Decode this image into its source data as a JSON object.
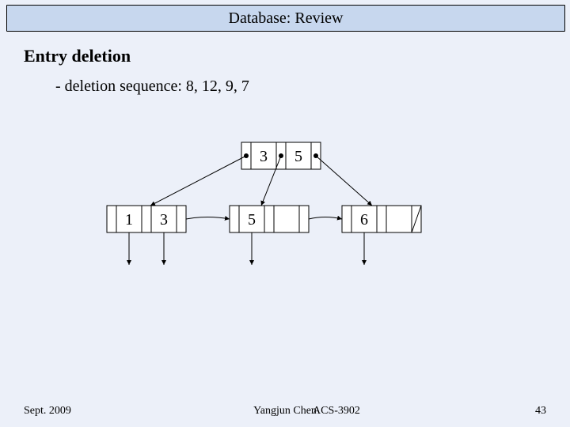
{
  "title": "Database: Review",
  "heading": "Entry deletion",
  "subheading": "- deletion sequence: 8, 12, 9, 7",
  "tree": {
    "root": {
      "keys": [
        "3",
        "5"
      ]
    },
    "leaves": [
      {
        "keys": [
          "1",
          "3"
        ]
      },
      {
        "keys": [
          "5",
          ""
        ]
      },
      {
        "keys": [
          "6",
          ""
        ]
      }
    ]
  },
  "footer": {
    "date": "Sept. 2009",
    "author": "Yangjun Chen",
    "course": "ACS-3902",
    "page": "43"
  }
}
